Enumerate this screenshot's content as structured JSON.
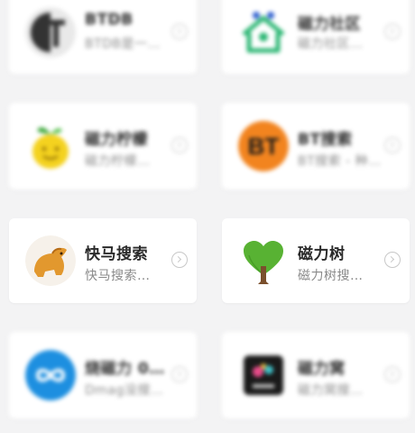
{
  "colors": {
    "background": "#f3f3f4",
    "card": "#ffffff",
    "title": "#2a2a2a",
    "subtitle": "#8a8a8a"
  },
  "apps": [
    {
      "title": "BTDB",
      "subtitle": "BTDB是一…",
      "icon": "btdb-logo-icon",
      "blurred": true
    },
    {
      "title": "磁力社区",
      "subtitle": "磁力社区…",
      "icon": "people-house-icon",
      "blurred": true
    },
    {
      "title": "磁力柠檬",
      "subtitle": "磁力柠檬…",
      "icon": "lemon-icon",
      "blurred": true
    },
    {
      "title": "BT搜索",
      "subtitle": "BT搜索 - 种…",
      "icon": "bt-logo-icon",
      "blurred": true
    },
    {
      "title": "快马搜索",
      "subtitle": "快马搜索…",
      "icon": "horse-icon",
      "blurred": false
    },
    {
      "title": "磁力树",
      "subtitle": "磁力树搜…",
      "icon": "heart-tree-icon",
      "blurred": false
    },
    {
      "title": "烧磁力 0…",
      "subtitle": "Dmag没搜…",
      "icon": "infinity-icon",
      "blurred": true
    },
    {
      "title": "磁力窝",
      "subtitle": "磁力窝搜…",
      "icon": "cube-icon",
      "blurred": true
    }
  ],
  "icon_texts": {
    "bt": "BT"
  }
}
